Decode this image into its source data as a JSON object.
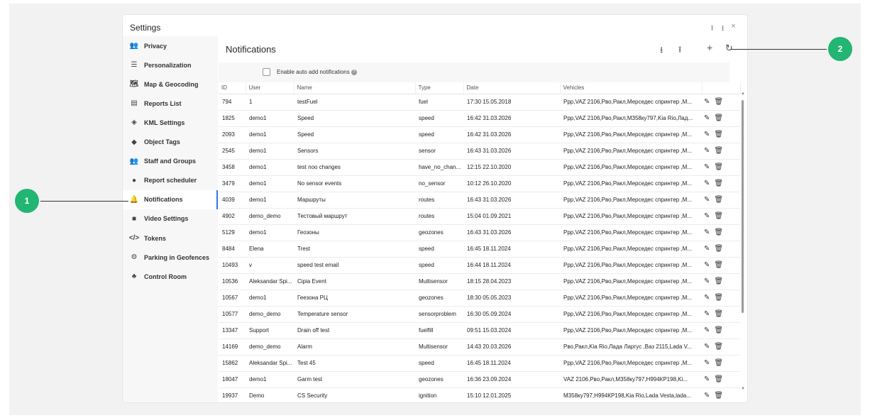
{
  "window": {
    "title": "Settings",
    "actions": [
      "⭱",
      "⭳",
      "×"
    ]
  },
  "sidebar": {
    "items": [
      {
        "label": "Privacy",
        "icon": "👥"
      },
      {
        "label": "Personalization",
        "icon": "☰"
      },
      {
        "label": "Map & Geocoding",
        "icon": "🗺"
      },
      {
        "label": "Reports List",
        "icon": "▤"
      },
      {
        "label": "KML Settings",
        "icon": "◈"
      },
      {
        "label": "Object Tags",
        "icon": "◆"
      },
      {
        "label": "Staff and Groups",
        "icon": "👥"
      },
      {
        "label": "Report scheduler",
        "icon": "●"
      },
      {
        "label": "Notifications",
        "icon": "🔔"
      },
      {
        "label": "Video Settings",
        "icon": "■"
      },
      {
        "label": "Tokens",
        "icon": "</>"
      },
      {
        "label": "Parking in Geofences",
        "icon": "⚙"
      },
      {
        "label": "Control Room",
        "icon": "♣"
      }
    ]
  },
  "main": {
    "title": "Notifications",
    "auto_add_label": "Enable auto add notifications",
    "icons": {
      "download": "⭳",
      "upload": "⭱",
      "add": "+",
      "refresh": "↻"
    }
  },
  "table": {
    "columns": [
      "ID",
      "User",
      "Name",
      "Type",
      "Date",
      "Vehicles"
    ],
    "rows": [
      [
        "794",
        "1",
        "testFuel",
        "fuel",
        "17:30 15.05.2018",
        "Ppp,VAZ 2106,Рво,Ракл,Мерседес спринтер ,M..."
      ],
      [
        "1825",
        "demo1",
        "Speed",
        "speed",
        "16:42 31.03.2026",
        "Ppp,VAZ 2106,Рво,Ракл,M358ку797,Kia Rio,Лад..."
      ],
      [
        "2093",
        "demo1",
        "Speed",
        "speed",
        "16:42 31.03.2026",
        "Ppp,VAZ 2106,Рво,Ракл,Мерседес спринтер ,M..."
      ],
      [
        "2545",
        "demo1",
        "Sensors",
        "sensor",
        "16:43 31.03.2026",
        "Ppp,VAZ 2106,Рво,Ракл,Мерседес спринтер ,M..."
      ],
      [
        "3458",
        "demo1",
        "test noo changes",
        "have_no_chan...",
        "12:15 22.10.2020",
        "Ppp,VAZ 2106,Рво,Ракл,Мерседес спринтер ,M..."
      ],
      [
        "3479",
        "demo1",
        "No sensor events",
        "no_sensor",
        "10:12 26.10.2020",
        "Ppp,VAZ 2106,Рво,Ракл,Мерседес спринтер ,M..."
      ],
      [
        "4039",
        "demo1",
        "Маршруты",
        "routes",
        "16:43 31.03.2026",
        "Ppp,VAZ 2106,Рво,Ракл,Мерседес спринтер ,M..."
      ],
      [
        "4902",
        "demo_demo",
        "Тестовый маршрут",
        "routes",
        "15:04 01.09.2021",
        "Ppp,VAZ 2106,Рво,Ракл,Мерседес спринтер ,M..."
      ],
      [
        "5129",
        "demo1",
        "Геозоны",
        "geozones",
        "16:43 31.03.2026",
        "Ppp,VAZ 2106,Рво,Ракл,Мерседес спринтер ,M..."
      ],
      [
        "8484",
        "Elena",
        "Trest",
        "speed",
        "16:45 18.11.2024",
        "Ppp,VAZ 2106,Рво,Ракл,Мерседес спринтер ,M..."
      ],
      [
        "10493",
        "v",
        "speed test email",
        "speed",
        "16:44 18.11.2024",
        "Ppp,VAZ 2106,Рво,Ракл,Мерседес спринтер ,M..."
      ],
      [
        "10536",
        "Aleksandar Spi...",
        "Cipia Event",
        "Multisensor",
        "18:15 28.04.2023",
        "Ppp,VAZ 2106,Рво,Ракл,Мерседес спринтер ,M..."
      ],
      [
        "10567",
        "demo1",
        "Геезона РЦ",
        "geozones",
        "18:30 05.05.2023",
        "Ppp,VAZ 2106,Рво,Ракл,Мерседес спринтер ,M..."
      ],
      [
        "10577",
        "demo_demo",
        "Temperature sensor",
        "sensorproblem",
        "16:30 05.09.2024",
        "Ppp,VAZ 2106,Рво,Ракл,Мерседес спринтер ,M..."
      ],
      [
        "13347",
        "Support",
        "Drain off test",
        "fuelfill",
        "09:51 15.03.2024",
        "Ppp,VAZ 2106,Рво,Ракл,Мерседес спринтер ,M..."
      ],
      [
        "14169",
        "demo_demo",
        "Alarm",
        "Multisensor",
        "14:43 20.03.2026",
        "Рво,Ракл,Kia Rio,Лада Ларгус ,Ваз 2115,Lada V..."
      ],
      [
        "15862",
        "Aleksandar Spi...",
        "Test 45",
        "speed",
        "16:45 18.11.2024",
        "Ppp,VAZ 2106,Рво,Ракл,Мерседес спринтер ,M..."
      ],
      [
        "18047",
        "demo1",
        "Garm test",
        "geozones",
        "16:36 23.09.2024",
        "VAZ 2106,Рво,Ракл,M358ку797,H994КР198,Ki..."
      ],
      [
        "19937",
        "Demo",
        "CS Security",
        "ignition",
        "15:10 12.01.2025",
        "M358ку797,H994КР198,Kia Rio,Lada Vesta,lada..."
      ]
    ]
  },
  "callouts": {
    "one": "1",
    "two": "2"
  },
  "colors": {
    "accent": "#2c7be5",
    "callout": "#22b573"
  }
}
